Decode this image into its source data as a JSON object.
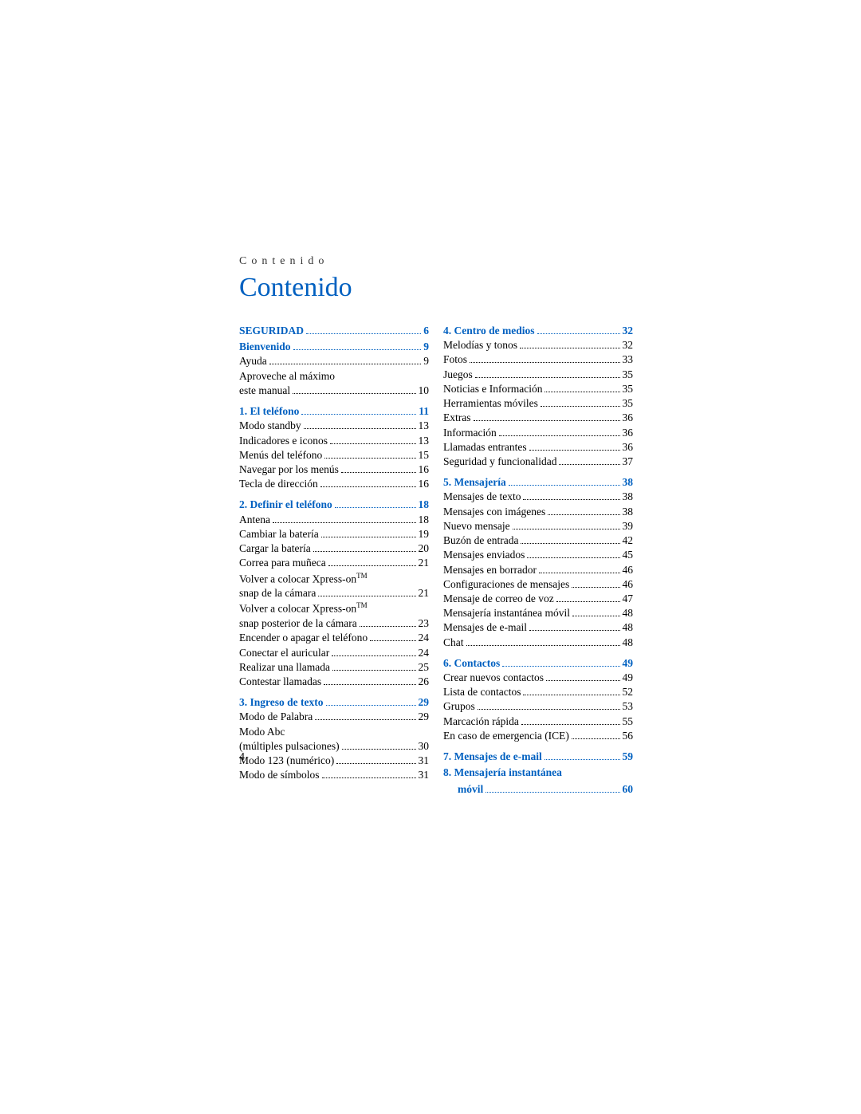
{
  "running_head": "Contenido",
  "title": "Contenido",
  "page_number": "4",
  "left": {
    "h0": {
      "label": "SEGURIDAD",
      "page": "6"
    },
    "h1": {
      "label": "Bienvenido",
      "page": "9"
    },
    "e0": {
      "label": "Ayuda",
      "page": "9"
    },
    "e1a": "Aproveche al máximo",
    "e1b": {
      "label": "este manual",
      "page": "10"
    },
    "h2": {
      "label": "1.  El teléfono",
      "page": "11"
    },
    "e2": {
      "label": "Modo standby",
      "page": "13"
    },
    "e3": {
      "label": "Indicadores e iconos",
      "page": "13"
    },
    "e4": {
      "label": "Menús del teléfono",
      "page": "15"
    },
    "e5": {
      "label": "Navegar por los menús",
      "page": "16"
    },
    "e6": {
      "label": "Tecla de dirección",
      "page": "16"
    },
    "h3": {
      "label": "2.  Definir el teléfono",
      "page": "18"
    },
    "e7": {
      "label": "Antena",
      "page": "18"
    },
    "e8": {
      "label": "Cambiar la batería",
      "page": "19"
    },
    "e9": {
      "label": "Cargar la batería",
      "page": "20"
    },
    "e10": {
      "label": "Correa para muñeca",
      "page": "21"
    },
    "e11a_pre": "Volver a colocar Xpress-on",
    "e11a_tm": "TM",
    "e11b": {
      "label": "snap de la cámara",
      "page": "21"
    },
    "e12a_pre": "Volver a colocar Xpress-on",
    "e12a_tm": "TM",
    "e12b": {
      "label": "snap posterior de la cámara",
      "page": "23"
    },
    "e13": {
      "label": "Encender o apagar el teléfono",
      "page": "24"
    },
    "e14": {
      "label": "Conectar el auricular",
      "page": "24"
    },
    "e15": {
      "label": "Realizar una llamada",
      "page": "25"
    },
    "e16": {
      "label": "Contestar llamadas",
      "page": "26"
    },
    "h4": {
      "label": "3.  Ingreso de texto",
      "page": "29"
    },
    "e17": {
      "label": "Modo de Palabra",
      "page": "29"
    },
    "e18a": "Modo Abc",
    "e18b": {
      "label": "(múltiples pulsaciones)",
      "page": "30"
    },
    "e19": {
      "label": "Modo 123 (numérico)",
      "page": "31"
    },
    "e20": {
      "label": "Modo de símbolos",
      "page": "31"
    }
  },
  "right": {
    "h0": {
      "label": "4.  Centro de medios",
      "page": "32"
    },
    "e0": {
      "label": "Melodías y tonos",
      "page": "32"
    },
    "e1": {
      "label": "Fotos",
      "page": "33"
    },
    "e2": {
      "label": "Juegos",
      "page": "35"
    },
    "e3": {
      "label": "Noticias e Información",
      "page": "35"
    },
    "e4": {
      "label": "Herramientas móviles",
      "page": "35"
    },
    "e5": {
      "label": "Extras",
      "page": "36"
    },
    "e6": {
      "label": "Información",
      "page": "36"
    },
    "e7": {
      "label": "Llamadas entrantes",
      "page": "36"
    },
    "e8": {
      "label": "Seguridad y funcionalidad",
      "page": "37"
    },
    "h1": {
      "label": "5.  Mensajería",
      "page": "38"
    },
    "e9": {
      "label": "Mensajes de texto",
      "page": "38"
    },
    "e10": {
      "label": "Mensajes con imágenes",
      "page": "38"
    },
    "e11": {
      "label": "Nuevo mensaje",
      "page": "39"
    },
    "e12": {
      "label": "Buzón de entrada",
      "page": "42"
    },
    "e13": {
      "label": "Mensajes enviados",
      "page": "45"
    },
    "e14": {
      "label": "Mensajes en borrador",
      "page": "46"
    },
    "e15": {
      "label": "Configuraciones de mensajes",
      "page": "46"
    },
    "e16": {
      "label": "Mensaje de correo de voz",
      "page": "47"
    },
    "e17": {
      "label": "Mensajería instantánea móvil",
      "page": "48"
    },
    "e18": {
      "label": "Mensajes de e-mail",
      "page": "48"
    },
    "e19": {
      "label": "Chat",
      "page": "48"
    },
    "h2": {
      "label": "6.  Contactos",
      "page": "49"
    },
    "e20": {
      "label": "Crear nuevos contactos",
      "page": "49"
    },
    "e21": {
      "label": "Lista de contactos",
      "page": "52"
    },
    "e22": {
      "label": "Grupos",
      "page": "53"
    },
    "e23": {
      "label": "Marcación rápida",
      "page": "55"
    },
    "e24": {
      "label": "En caso de emergencia (ICE)",
      "page": "56"
    },
    "h3": {
      "label": "7.  Mensajes de e-mail",
      "page": "59"
    },
    "h4a": "8.  Mensajería instantánea",
    "h4b": {
      "label": "móvil",
      "page": "60"
    }
  }
}
